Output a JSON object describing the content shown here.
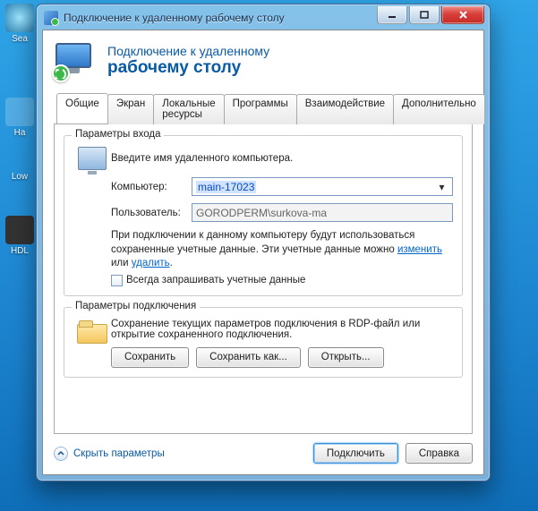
{
  "desktop": {
    "items": [
      "Sea",
      "Ha",
      "Low",
      "HDL"
    ]
  },
  "window": {
    "title": "Подключение к удаленному рабочему столу"
  },
  "header": {
    "line1": "Подключение к удаленному",
    "line2": "рабочему столу"
  },
  "tabs": [
    "Общие",
    "Экран",
    "Локальные ресурсы",
    "Программы",
    "Взаимодействие",
    "Дополнительно"
  ],
  "login_group": {
    "title": "Параметры входа",
    "instruction": "Введите имя удаленного компьютера.",
    "computer_label": "Компьютер:",
    "computer_value": "main-17023",
    "user_label": "Пользователь:",
    "user_value": "GORODPERM\\surkova-ma",
    "note_part1": "При подключении к данному компьютеру будут использоваться сохраненные учетные данные. Эти учетные данные можно ",
    "note_link1": "изменить",
    "note_part2": " или ",
    "note_link2": "удалить",
    "note_part3": ".",
    "checkbox_label": "Всегда запрашивать учетные данные"
  },
  "conn_group": {
    "title": "Параметры подключения",
    "desc": "Сохранение текущих параметров подключения в RDP-файл или открытие сохраненного подключения.",
    "save": "Сохранить",
    "save_as": "Сохранить как...",
    "open": "Открыть..."
  },
  "footer": {
    "options": "Скрыть параметры",
    "connect": "Подключить",
    "help": "Справка"
  }
}
